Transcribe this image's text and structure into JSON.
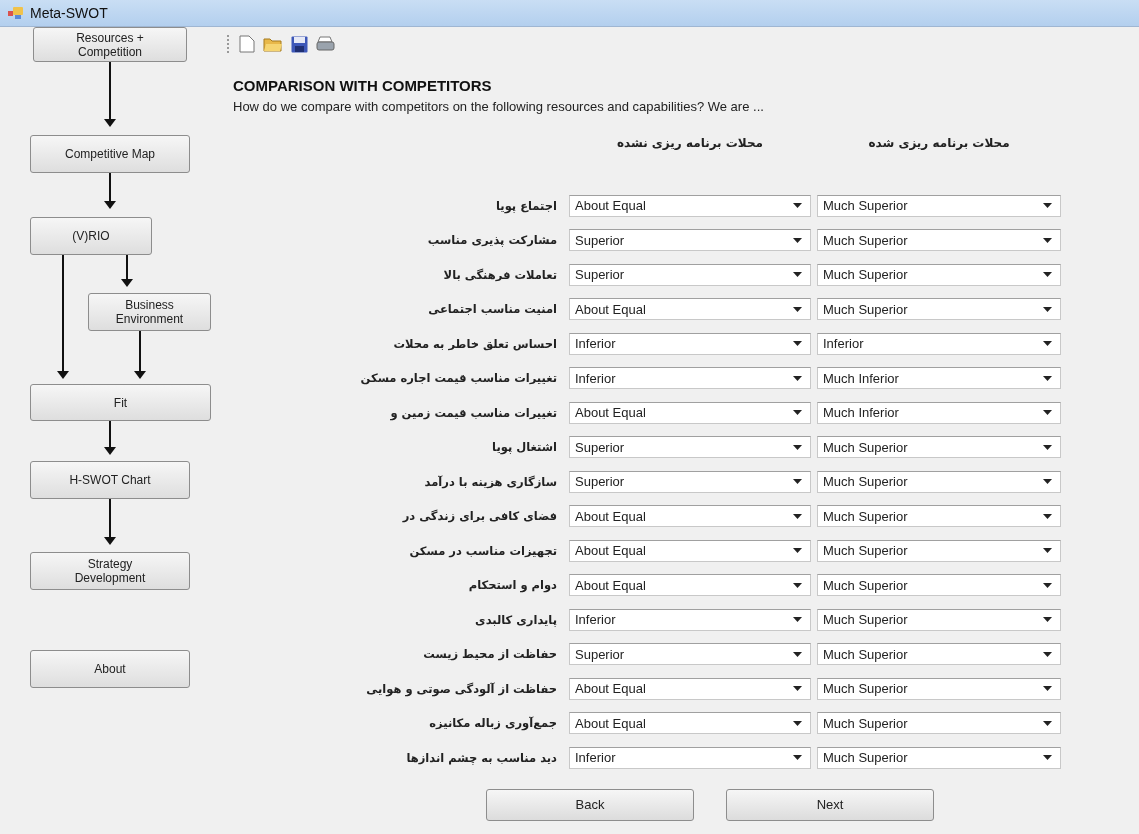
{
  "window": {
    "title": "Meta-SWOT"
  },
  "sidebar": {
    "nodes": [
      {
        "label": "Resources +\nCompetition"
      },
      {
        "label": "Competitive Map"
      },
      {
        "label": "(V)RIO"
      },
      {
        "label": "Business\nEnvironment"
      },
      {
        "label": "Fit"
      },
      {
        "label": "H-SWOT Chart"
      },
      {
        "label": "Strategy\nDevelopment"
      },
      {
        "label": "About"
      }
    ]
  },
  "heading": "COMPARISON WITH COMPETITORS",
  "question": "How do we compare with competitors on the following resources and capabilities? We are ...",
  "resources": [
    "اجتماع پویا",
    "مشارکت پذیری مناسب",
    "تعاملات فرهنگی بالا",
    "امنیت مناسب اجتماعی",
    "احساس تعلق خاطر به محلات",
    "تغییرات  مناسب قیمت اجاره مسکن",
    "تغییرات  مناسب قیمت زمین و",
    "اشتغال پویا",
    "سازگاری هزینه با درآمد",
    "فضای کافی برای زندگی در",
    "تجهیزات مناسب در مسکن",
    "دوام و استحکام",
    "پایداری کالبدی",
    "حفاظت از محیط زیست",
    "حفاظت از آلودگی صوتی و هوایی",
    "جمع‌آوری زباله مکانیزه",
    "دید مناسب به چشم اندازها"
  ],
  "column_1": {
    "header": "محلات برنامه ریزی نشده",
    "values": [
      "About Equal",
      "Superior",
      "Superior",
      "About Equal",
      "Inferior",
      "Inferior",
      "About Equal",
      "Superior",
      "Superior",
      "About Equal",
      "About Equal",
      "About Equal",
      "Inferior",
      "Superior",
      "About Equal",
      "About Equal",
      "Inferior"
    ]
  },
  "column_2": {
    "header": "محلات برنامه ریزی شده",
    "values": [
      "Much Superior",
      "Much Superior",
      "Much Superior",
      "Much Superior",
      "Inferior",
      "Much Inferior",
      "Much Inferior",
      "Much Superior",
      "Much Superior",
      "Much Superior",
      "Much Superior",
      "Much Superior",
      "Much Superior",
      "Much Superior",
      "Much Superior",
      "Much Superior",
      "Much Superior"
    ]
  },
  "buttons": [
    "Back",
    "Next"
  ]
}
